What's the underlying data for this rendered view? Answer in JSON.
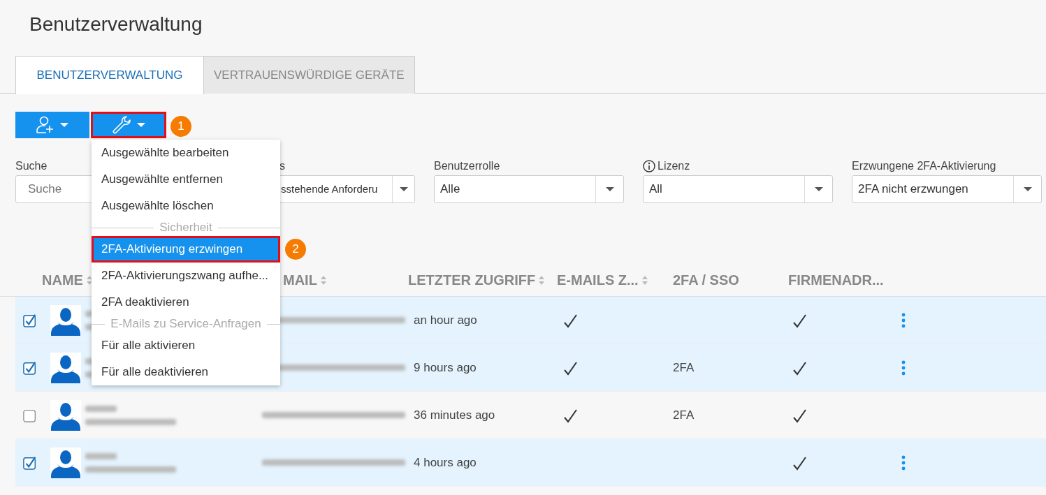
{
  "page_title": "Benutzerverwaltung",
  "tabs": [
    {
      "label": "BENUTZERVERWALTUNG",
      "selected": true
    },
    {
      "label": "VERTRAUENSWÜRDIGE GERÄTE",
      "selected": false
    }
  ],
  "toolbar": [
    {
      "kind": "add-user"
    },
    {
      "kind": "tools",
      "outlined": true,
      "callout": "1"
    }
  ],
  "filters": [
    {
      "label": "Suche",
      "placeholder": "Suche",
      "kind": "search"
    },
    {
      "label": "s",
      "value": "sstehende Anforderu",
      "kind": "select"
    },
    {
      "label": "Benutzerrolle",
      "value": "Alle",
      "kind": "select"
    },
    {
      "label": "Lizenz",
      "value": "All",
      "kind": "select",
      "info": true
    },
    {
      "label": "Erzwungene 2FA-Aktivierung",
      "value": "2FA nicht erzwungen",
      "kind": "select"
    }
  ],
  "table": {
    "columns": [
      {
        "label": "NAME",
        "sortable": true
      },
      {
        "label": "MAIL",
        "sortable": true
      },
      {
        "label": "LETZTER ZUGRIFF",
        "sortable": true
      },
      {
        "label": "E-MAILS Z...",
        "sortable": true
      },
      {
        "label": "2FA / SSO"
      },
      {
        "label": "FIRMENADR..."
      }
    ],
    "rows": [
      {
        "selected": true,
        "last_access": "an hour ago",
        "emails": true,
        "twofa": "",
        "company_address": true,
        "menu": true
      },
      {
        "selected": true,
        "last_access": "9 hours ago",
        "emails": true,
        "twofa": "2FA",
        "company_address": true,
        "menu": true
      },
      {
        "selected": false,
        "last_access": "36 minutes ago",
        "emails": true,
        "twofa": "2FA",
        "company_address": true,
        "menu": false
      },
      {
        "selected": true,
        "last_access": "4 hours ago",
        "emails": false,
        "twofa": "",
        "company_address": true,
        "menu": true
      }
    ]
  },
  "menu": [
    {
      "kind": "item",
      "label": "Ausgewählte bearbeiten",
      "selected": false
    },
    {
      "kind": "item",
      "label": "Ausgewählte entfernen",
      "selected": false
    },
    {
      "kind": "item",
      "label": "Ausgewählte löschen",
      "selected": false
    },
    {
      "kind": "heading",
      "label": "Sicherheit"
    },
    {
      "kind": "item",
      "label": "2FA-Aktivierung erzwingen",
      "selected": true,
      "callout": "2"
    },
    {
      "kind": "item",
      "label": "2FA-Aktivierungszwang aufhe...",
      "selected": false
    },
    {
      "kind": "item",
      "label": "2FA deaktivieren",
      "selected": false
    },
    {
      "kind": "heading",
      "label": "E-Mails zu Service-Anfragen"
    },
    {
      "kind": "item",
      "label": "Für alle aktivieren",
      "selected": false
    },
    {
      "kind": "item",
      "label": "Für alle deaktivieren",
      "selected": false
    }
  ]
}
